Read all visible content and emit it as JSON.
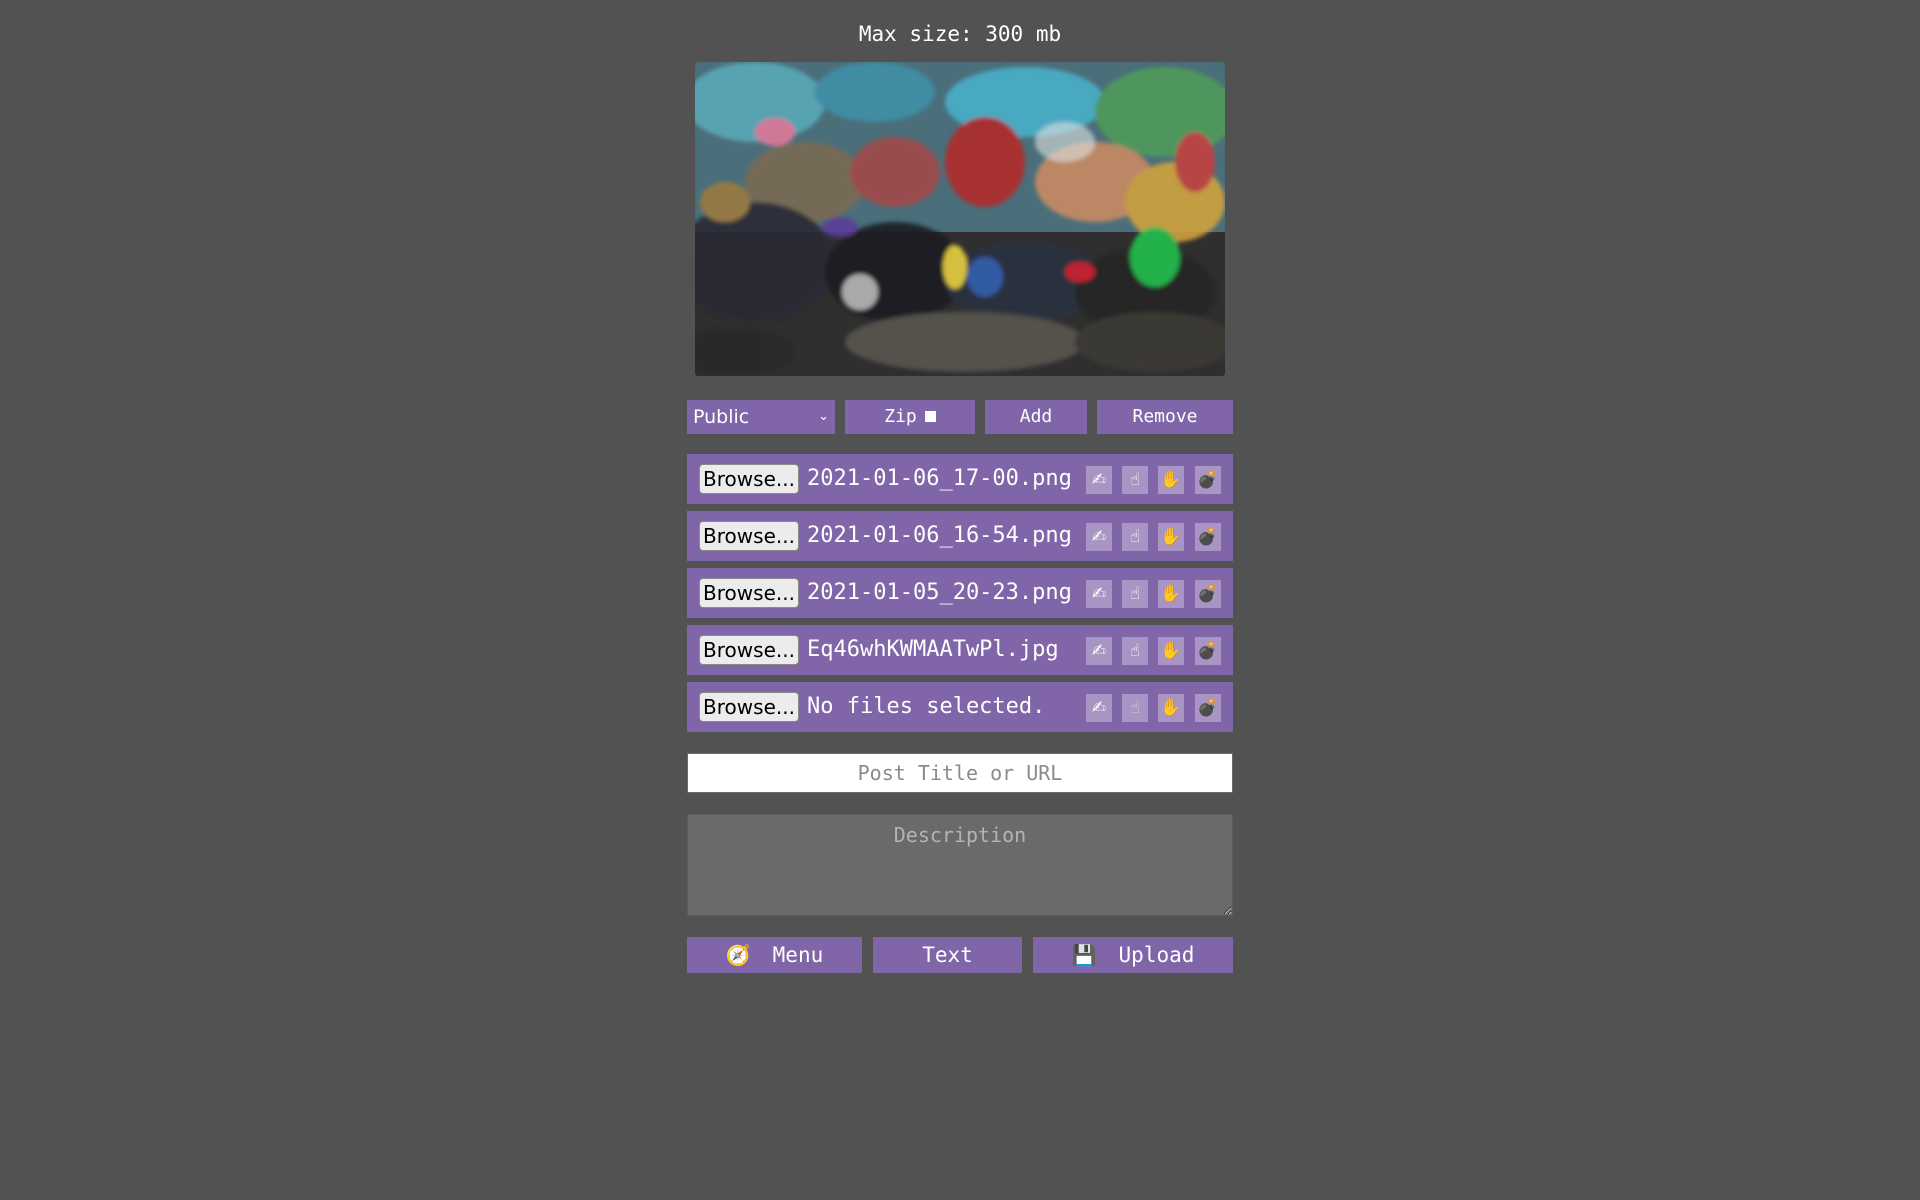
{
  "header": {
    "max_size_text": "Max size: 300 mb"
  },
  "controls": {
    "visibility_selected": "Public",
    "zip_label": "Zip",
    "add_label": "Add",
    "remove_label": "Remove"
  },
  "files": [
    {
      "browse_label": "Browse...",
      "name": "2021-01-06_17-00.png",
      "active": true
    },
    {
      "browse_label": "Browse...",
      "name": "2021-01-06_16-54.png",
      "active": true
    },
    {
      "browse_label": "Browse...",
      "name": "2021-01-05_20-23.png",
      "active": true
    },
    {
      "browse_label": "Browse...",
      "name": "Eq46whKWMAATwPl.jpg",
      "active": true
    },
    {
      "browse_label": "Browse...",
      "name": "No files selected.",
      "active": false
    }
  ],
  "row_actions": {
    "icons": [
      "writing-hand-icon",
      "pointing-up-icon",
      "raised-hand-icon",
      "bomb-icon"
    ],
    "glyphs": [
      "✍",
      "☝",
      "✋",
      "💣"
    ]
  },
  "form": {
    "title_placeholder": "Post Title or URL",
    "description_placeholder": "Description"
  },
  "bottom": {
    "menu_icon": "compass-icon",
    "menu_label": "Menu",
    "text_label": "Text",
    "upload_icon": "floppy-disk-icon",
    "upload_label": "Upload"
  },
  "colors": {
    "background": "#525252",
    "accent": "#8066a8",
    "action_bg": "#a995c4"
  }
}
